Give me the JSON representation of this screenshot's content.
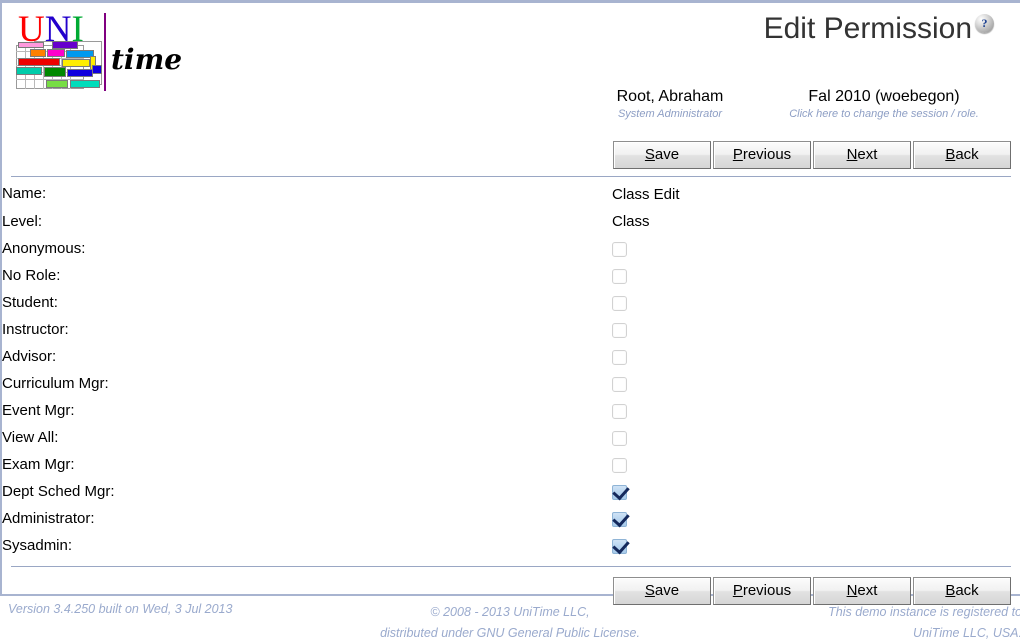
{
  "header": {
    "logo": {
      "uni_u": "U",
      "uni_ni": "NI",
      "uni_n": "N",
      "uni_i": "I",
      "time": "time"
    },
    "title": "Edit Permission",
    "help_icon": "?",
    "user": {
      "name": "Root, Abraham",
      "role": "System Administrator"
    },
    "session": {
      "name": "Fal 2010 (woebegon)",
      "hint": "Click here to change the session / role."
    }
  },
  "toolbar": {
    "save_label": "Save",
    "save_key": "S",
    "save_rest": "ave",
    "previous_label": "Previous",
    "previous_key": "P",
    "previous_rest": "revious",
    "next_label": "Next",
    "next_key": "N",
    "next_rest": "ext",
    "back_label": "Back",
    "back_key": "B",
    "back_rest": "ack"
  },
  "form": {
    "text_fields": [
      {
        "label": "Name:",
        "value": "Class Edit"
      },
      {
        "label": "Level:",
        "value": "Class"
      }
    ],
    "checkbox_fields": [
      {
        "label": "Anonymous:",
        "checked": false
      },
      {
        "label": "No Role:",
        "checked": false
      },
      {
        "label": "Student:",
        "checked": false
      },
      {
        "label": "Instructor:",
        "checked": false
      },
      {
        "label": "Advisor:",
        "checked": false
      },
      {
        "label": "Curriculum Mgr:",
        "checked": false
      },
      {
        "label": "Event Mgr:",
        "checked": false
      },
      {
        "label": "View All:",
        "checked": false
      },
      {
        "label": "Exam Mgr:",
        "checked": false
      },
      {
        "label": "Dept Sched Mgr:",
        "checked": true
      },
      {
        "label": "Administrator:",
        "checked": true
      },
      {
        "label": "Sysadmin:",
        "checked": true
      }
    ]
  },
  "footer": {
    "version": "Version 3.4.250 built on Wed, 3 Jul 2013",
    "copyright_line1": "© 2008 - 2013 UniTime LLC,",
    "copyright_line2": "distributed under GNU General Public License.",
    "registration_line1": "This demo instance is registered to",
    "registration_line2": "UniTime LLC, USA."
  },
  "colors": {
    "border": "#a8b4d0",
    "footer_text": "#9aaacd",
    "sub_text": "#8d9ec4",
    "checkbox_checked": "#b5d3ef",
    "checkmark": "#15295c",
    "logo_u": "#ff0000",
    "logo_n": "#2200cc",
    "logo_i": "#00aa33",
    "logo_bar": "#800080"
  }
}
